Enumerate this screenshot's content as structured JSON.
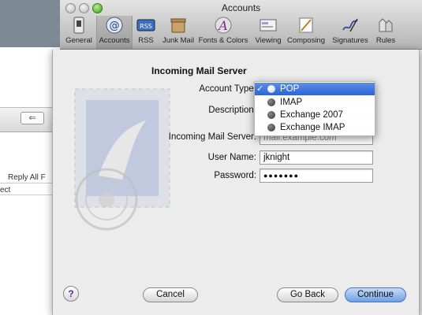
{
  "background_window": {
    "reply_all_label": "Reply All  F",
    "subject_fragment": "ect"
  },
  "window": {
    "title": "Accounts",
    "toolbar": [
      {
        "label": "General",
        "icon": "switch-icon"
      },
      {
        "label": "Accounts",
        "icon": "at-sign-icon"
      },
      {
        "label": "RSS",
        "icon": "rss-icon"
      },
      {
        "label": "Junk Mail",
        "icon": "junk-mail-icon"
      },
      {
        "label": "Fonts & Colors",
        "icon": "fonts-colors-icon"
      },
      {
        "label": "Viewing",
        "icon": "viewing-icon"
      },
      {
        "label": "Composing",
        "icon": "composing-icon"
      },
      {
        "label": "Signatures",
        "icon": "signatures-icon"
      },
      {
        "label": "Rules",
        "icon": "rules-icon"
      }
    ],
    "selected_tab": "Accounts"
  },
  "sheet": {
    "heading": "Incoming Mail Server",
    "fields": {
      "account_type_label": "Account Type:",
      "description_label": "Description:",
      "incoming_server_label": "Incoming Mail Server:",
      "incoming_server_placeholder": "mail.example.com",
      "user_name_label": "User Name:",
      "user_name_value": "jknight",
      "password_label": "Password:",
      "password_value": "●●●●●●●"
    },
    "account_type_menu": {
      "selected": "POP",
      "options": [
        "POP",
        "IMAP",
        "Exchange 2007",
        "Exchange IMAP"
      ]
    },
    "buttons": {
      "cancel": "Cancel",
      "go_back": "Go Back",
      "continue": "Continue",
      "help": "?"
    }
  },
  "colors": {
    "highlight": "#2d63d5",
    "default_button": "#6f9fe4"
  }
}
